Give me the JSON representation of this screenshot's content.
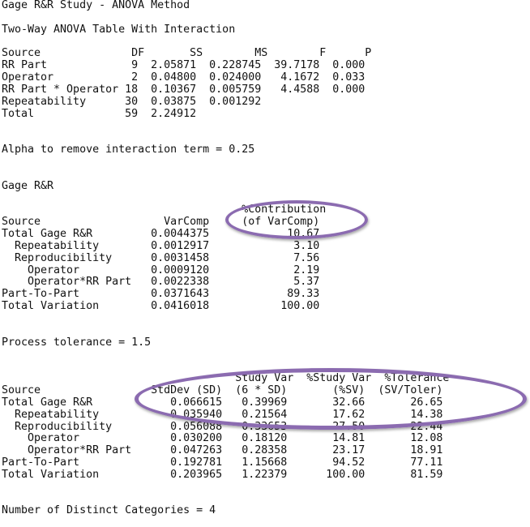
{
  "lines": [
    "Gage R&R Study - ANOVA Method",
    "",
    "Two-Way ANOVA Table With Interaction",
    "",
    "Source              DF       SS        MS        F      P",
    "RR Part             9  2.05871  0.228745  39.7178  0.000",
    "Operator            2  0.04800  0.024000   4.1672  0.033",
    "RR Part * Operator 18  0.10367  0.005759   4.4588  0.000",
    "Repeatability      30  0.03875  0.001292",
    "Total              59  2.24912",
    "",
    "",
    "Alpha to remove interaction term = 0.25",
    "",
    "",
    "Gage R&R",
    "",
    "                                     %Contribution",
    "Source                   VarComp     (of VarComp)",
    "Total Gage R&R         0.0044375            10.67",
    "  Repeatability        0.0012917             3.10",
    "  Reproducibility      0.0031458             7.56",
    "    Operator           0.0009120             2.19",
    "    Operator*RR Part   0.0022338             5.37",
    "Part-To-Part           0.0371643            89.33",
    "Total Variation        0.0416018           100.00",
    "",
    "",
    "Process tolerance = 1.5",
    "",
    "",
    "                                    Study Var  %Study Var  %Tolerance",
    "Source                 StdDev (SD)  (6 * SD)       (%SV)  (SV/Toler)",
    "Total Gage R&R            0.066615   0.39969       32.66       26.65",
    "  Repeatability           0.035940   0.21564       17.62       14.38",
    "  Reproducibility         0.056088   0.33653       27.50       22.44",
    "    Operator              0.030200   0.18120       14.81       12.08",
    "    Operator*RR Part      0.047263   0.28358       23.17       18.91",
    "Part-To-Part              0.192781   1.15668       94.52       77.11",
    "Total Variation           0.203965   1.22379      100.00       81.59",
    "",
    "",
    "Number of Distinct Categories = 4"
  ],
  "highlight_color": "#8B6BB0"
}
